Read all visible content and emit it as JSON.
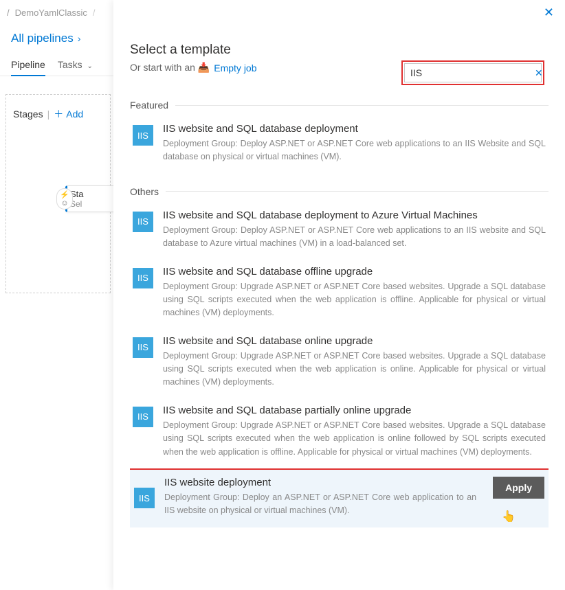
{
  "breadcrumb": {
    "project": "DemoYamlClassic"
  },
  "nav": {
    "all_pipelines": "All pipelines"
  },
  "tabs": {
    "pipeline": "Pipeline",
    "tasks": "Tasks"
  },
  "stages": {
    "label": "Stages",
    "add": "Add",
    "card": {
      "title": "Sta",
      "subtitle": "Sel"
    }
  },
  "panel": {
    "title": "Select a template",
    "subtitle_prefix": "Or start with an ",
    "empty_job": "Empty job",
    "search": {
      "value": "IIS"
    },
    "sections": {
      "featured": "Featured",
      "others": "Others"
    },
    "templates": {
      "featured": [
        {
          "badge": "IIS",
          "title": "IIS website and SQL database deployment",
          "desc": "Deployment Group: Deploy ASP.NET or ASP.NET Core web applications to an IIS Website and SQL database on physical or virtual machines (VM)."
        }
      ],
      "others": [
        {
          "badge": "IIS",
          "title": "IIS website and SQL database deployment to Azure Virtual Machines",
          "desc": "Deployment Group: Deploy ASP.NET or ASP.NET Core web applications to an IIS website and SQL database to Azure virtual machines (VM) in a load-balanced set."
        },
        {
          "badge": "IIS",
          "title": "IIS website and SQL database offline upgrade",
          "desc": "Deployment Group: Upgrade ASP.NET or ASP.NET Core based websites. Upgrade a SQL database using SQL scripts executed when the web application is offline. Applicable for physical or virtual machines (VM) deployments."
        },
        {
          "badge": "IIS",
          "title": "IIS website and SQL database online upgrade",
          "desc": "Deployment Group: Upgrade ASP.NET or ASP.NET Core based websites. Upgrade a SQL database using SQL scripts executed when the web application is online. Applicable for physical or virtual machines (VM) deployments."
        },
        {
          "badge": "IIS",
          "title": "IIS website and SQL database partially online upgrade",
          "desc": "Deployment Group: Upgrade ASP.NET or ASP.NET Core based websites. Upgrade a SQL database using SQL scripts executed when the web application is online followed by SQL scripts executed when the web application is offline. Applicable for physical or virtual machines (VM) deployments."
        },
        {
          "badge": "IIS",
          "title": "IIS website deployment",
          "desc": "Deployment Group: Deploy an ASP.NET or ASP.NET Core web application to an IIS website on physical or virtual machines (VM).",
          "selected": true
        }
      ]
    },
    "apply": "Apply"
  }
}
